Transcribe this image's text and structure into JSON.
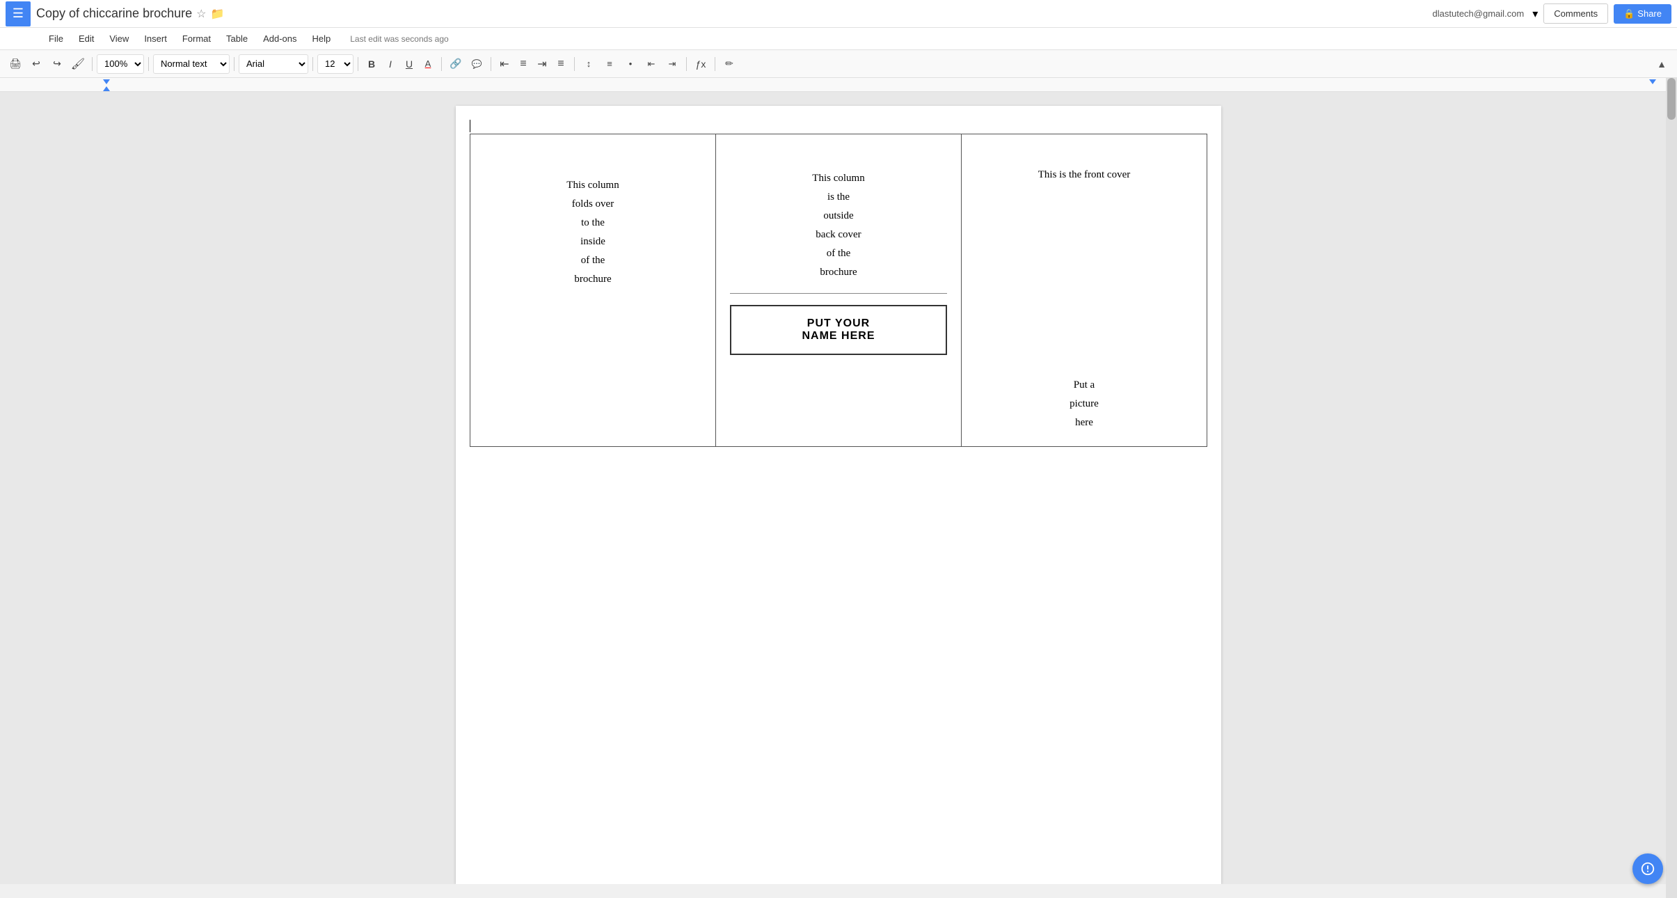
{
  "app": {
    "menu_icon": "☰",
    "title": "Copy of chiccarine brochure",
    "star": "☆",
    "folder": "📁"
  },
  "topright": {
    "user_email": "dlastutech@gmail.com",
    "user_arrow": "▾",
    "comments_label": "Comments",
    "share_icon": "🔒",
    "share_label": "Share"
  },
  "menubar": {
    "items": [
      "File",
      "Edit",
      "View",
      "Insert",
      "Format",
      "Table",
      "Add-ons",
      "Help"
    ],
    "last_edit": "Last edit was seconds ago"
  },
  "toolbar": {
    "print": "🖨",
    "undo": "↩",
    "redo": "↪",
    "paint": "🖌",
    "zoom": "100%",
    "style": "Normal text",
    "font": "Arial",
    "size": "12",
    "bold": "B",
    "italic": "I",
    "underline": "U",
    "text_color": "A",
    "link": "🔗",
    "comment": "💬",
    "align_left": "≡",
    "align_center": "≡",
    "align_right": "≡",
    "align_justify": "≡",
    "line_spacing": "↕",
    "numbered_list": "1≡",
    "bullet_list": "•≡",
    "indent_less": "⇤",
    "indent_more": "⇥",
    "formula": "fx",
    "pen": "✏",
    "collapse": "▲"
  },
  "brochure": {
    "col1": {
      "text": "This column\nfolds over\nto the\ninside\nof the\nbrochure"
    },
    "col2": {
      "text": "This column\nis the\noutside\nback cover\nof the\nbrochure",
      "name_line1": "PUT YOUR",
      "name_line2": "NAME HERE"
    },
    "col3": {
      "text": "This is the front cover",
      "picture": "Put a\npicture\nhere"
    }
  }
}
